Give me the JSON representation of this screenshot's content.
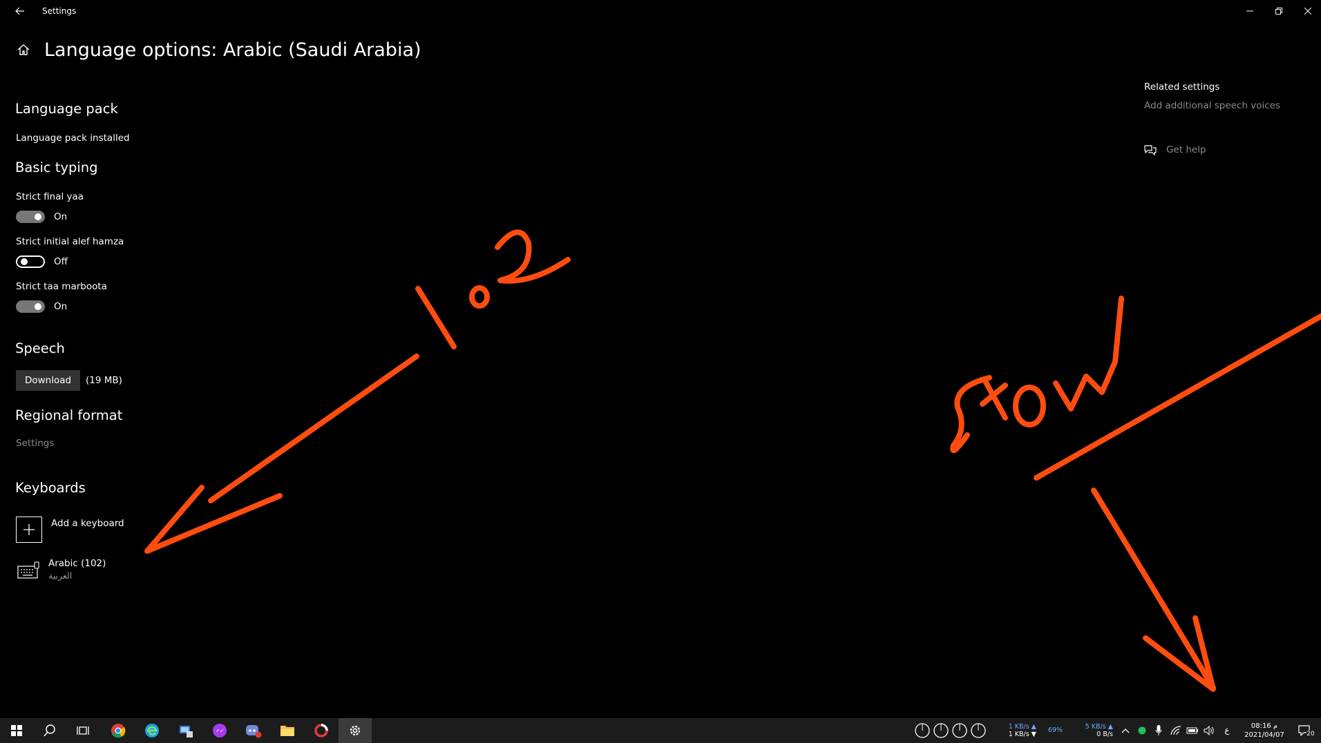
{
  "window": {
    "title": "Settings"
  },
  "page": {
    "title": "Language options: Arabic (Saudi Arabia)"
  },
  "language_pack": {
    "heading": "Language pack",
    "status": "Language pack installed"
  },
  "basic_typing": {
    "heading": "Basic typing",
    "options": [
      {
        "label": "Strict final yaa",
        "state": "On"
      },
      {
        "label": "Strict initial alef hamza",
        "state": "Off"
      },
      {
        "label": "Strict taa marboota",
        "state": "On"
      }
    ]
  },
  "speech": {
    "heading": "Speech",
    "download_label": "Download",
    "size": "(19 MB)"
  },
  "regional_format": {
    "heading": "Regional format",
    "link": "Settings"
  },
  "keyboards": {
    "heading": "Keyboards",
    "add_label": "Add a keyboard",
    "items": [
      {
        "name": "Arabic (102)",
        "native": "العربية"
      }
    ]
  },
  "related_settings": {
    "heading": "Related settings",
    "link": "Add additional speech voices",
    "help": "Get help"
  },
  "annotations": {
    "text1": "1o2",
    "text2": "Show"
  },
  "taskbar": {
    "net1_up": "1 KB/s ▲",
    "net1_down": "1 KB/s ▼",
    "cpu": "69%",
    "net2_up": "5 KB/s ▲",
    "net2_down": "0 B/s",
    "ime": "ع",
    "time": "08:16 م",
    "date": "2021/04/07",
    "notifications": "20"
  },
  "colors": {
    "annotation": "#ff4d10",
    "toggle_on": "#777777",
    "muted_text": "#8a8a8a",
    "taskbar": "#1c1c1c"
  }
}
